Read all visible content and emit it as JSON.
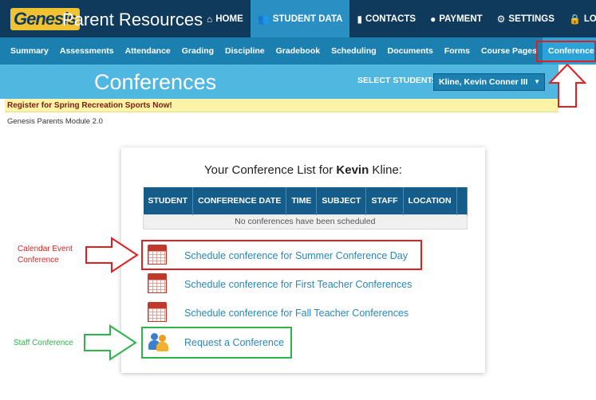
{
  "app": {
    "logo_text": "Genesis",
    "title": "Parent Resources"
  },
  "topnav": [
    {
      "label": "HOME",
      "icon": "home-icon",
      "glyph": "⌂"
    },
    {
      "label": "STUDENT DATA",
      "icon": "users-icon",
      "glyph": "👥"
    },
    {
      "label": "CONTACTS",
      "icon": "book-icon",
      "glyph": "▮"
    },
    {
      "label": "PAYMENT",
      "icon": "payment-icon",
      "glyph": "●"
    },
    {
      "label": "SETTINGS",
      "icon": "gear-icon",
      "glyph": "⚙"
    },
    {
      "label": "LOGOUT",
      "icon": "lock-icon",
      "glyph": "🔒"
    }
  ],
  "subnav": [
    "Summary",
    "Assessments",
    "Attendance",
    "Grading",
    "Discipline",
    "Gradebook",
    "Scheduling",
    "Documents",
    "Forms",
    "Course Pages",
    "Conferences"
  ],
  "page": {
    "title": "Conferences",
    "select_label": "SELECT STUDENT:",
    "selected_student": "Kline, Kevin Conner III",
    "announcement": "Register for Spring Recreation Sports Now!",
    "module_version": "Genesis Parents Module 2.0"
  },
  "panel": {
    "title_prefix": "Your Conference List for ",
    "student_first": "Kevin",
    "student_last": " Kline:",
    "columns": [
      "STUDENT",
      "CONFERENCE DATE",
      "TIME",
      "SUBJECT",
      "STAFF",
      "LOCATION"
    ],
    "empty_message": "No conferences have been scheduled",
    "links": [
      "Schedule conference for Summer Conference Day",
      "Schedule conference for First Teacher Conferences",
      "Schedule conference for Fall Teacher Conferences",
      "Request a Conference"
    ]
  },
  "annotations": {
    "calendar_event_line1": "Calendar Event",
    "calendar_event_line2": "Conference",
    "staff_conference": "Staff Conference",
    "red_color": "#e02020",
    "green_color": "#2db44a"
  },
  "colors": {
    "topbar": "#0f3a5c",
    "subnav": "#1b80b0",
    "header": "#4fb7e0",
    "link": "#2a87b8"
  }
}
